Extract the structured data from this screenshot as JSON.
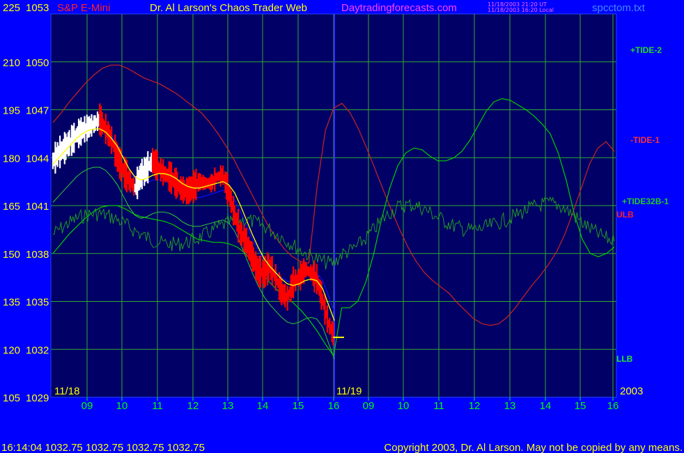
{
  "header": {
    "product": "S&P E-Mini",
    "title": "Dr. Al Larson's Chaos Trader Web",
    "site": "Daytradingforecasts.com",
    "stamp_line1": "11/18/2003 21:20 UT",
    "stamp_line2": "11/18/2003 16:20 Local",
    "file": "spcctom.txt"
  },
  "footer": {
    "quote": "16:14:04  1032.75 1032.75 1032.75 1032.75",
    "copyright": "Copyright 2003, Dr. Al Larson. May not be copied by any means."
  },
  "chart_data": {
    "type": "line",
    "y_left_ticks": [
      225,
      210,
      195,
      180,
      165,
      150,
      135,
      120,
      105
    ],
    "y_right_ticks": [
      1053,
      1050,
      1047,
      1044,
      1041,
      1038,
      1035,
      1032,
      1029
    ],
    "ylim": [
      1029,
      1053
    ],
    "x_ticks": [
      "09",
      "10",
      "11",
      "12",
      "13",
      "14",
      "15",
      "16",
      "09",
      "10",
      "11",
      "12",
      "13",
      "14",
      "15",
      "16"
    ],
    "date_labels": [
      "11/18",
      "11/19",
      "2003"
    ],
    "grid": true,
    "colors": {
      "background": "#000066",
      "grid": "#33aa33",
      "price": "#ff0000",
      "price_up": "#ffffff",
      "average": "#ffff00",
      "tide2": "#00cc00",
      "tide1": "#cc2222",
      "tide32b": "#229922",
      "envelope": "#1111ff"
    },
    "series_labels": [
      "+TIDE-2",
      "-TIDE-1",
      "+TIDE32B-1",
      "ULB",
      "LLB"
    ],
    "last_price": 1032.75,
    "price": [
      1043.8,
      1044.3,
      1044.6,
      1045.0,
      1045.4,
      1045.7,
      1045.9,
      1046.1,
      1046.4,
      1045.8,
      1045.1,
      1044.0,
      1043.2,
      1042.6,
      1042.1,
      1042.9,
      1043.3,
      1043.8,
      1043.4,
      1043.0,
      1042.8,
      1042.4,
      1042.0,
      1041.9,
      1042.2,
      1042.5,
      1042.4,
      1042.4,
      1042.8,
      1042.9,
      1041.8,
      1040.4,
      1039.3,
      1038.7,
      1037.8,
      1036.9,
      1036.8,
      1037.2,
      1036.5,
      1035.6,
      1035.2,
      1036.2,
      1036.5,
      1037.0,
      1036.8,
      1036.4,
      1035.1,
      1033.6,
      1032.8
    ],
    "average": [
      1043.6,
      1044.0,
      1044.4,
      1044.8,
      1045.2,
      1045.5,
      1045.7,
      1045.8,
      1045.8,
      1045.6,
      1045.2,
      1044.7,
      1044.0,
      1043.3,
      1042.8,
      1042.6,
      1042.7,
      1042.9,
      1043.0,
      1043.0,
      1042.9,
      1042.7,
      1042.4,
      1042.2,
      1042.1,
      1042.1,
      1042.2,
      1042.3,
      1042.4,
      1042.5,
      1042.3,
      1041.8,
      1041.0,
      1040.1,
      1039.2,
      1038.4,
      1037.7,
      1037.2,
      1036.8,
      1036.4,
      1036.1,
      1036.0,
      1036.1,
      1036.3,
      1036.4,
      1036.3,
      1035.8,
      1034.8,
      1033.8
    ],
    "tide2": [
      1038.0,
      1038.6,
      1039.2,
      1039.7,
      1040.2,
      1040.6,
      1040.9,
      1041.0,
      1041.0,
      1040.8,
      1040.5,
      1040.3,
      1040.2,
      1040.1,
      1040.0,
      1039.8,
      1039.5,
      1039.2,
      1038.9,
      1038.8,
      1038.7,
      1038.7,
      1038.6,
      1038.4,
      1038.0,
      1037.4,
      1036.8,
      1036.2,
      1035.7,
      1035.3,
      1034.9,
      1034.4,
      1033.8,
      1033.1,
      1032.3,
      1031.6,
      1034.6,
      1034.6,
      1035.0,
      1036.2,
      1038.0,
      1040.2,
      1042.1,
      1043.5,
      1044.3,
      1044.6,
      1044.5,
      1044.1,
      1043.8,
      1043.8,
      1044.0,
      1044.4,
      1045.1,
      1046.0,
      1046.9,
      1047.5,
      1047.7,
      1047.6,
      1047.3,
      1047.0,
      1046.6,
      1046.1,
      1045.5,
      1044.3,
      1042.6,
      1040.5,
      1038.9,
      1038.0,
      1037.8,
      1038.0,
      1038.4
    ],
    "tide1": [
      1046.2,
      1046.8,
      1047.5,
      1048.1,
      1048.7,
      1049.2,
      1049.6,
      1049.8,
      1049.8,
      1049.6,
      1049.3,
      1049.0,
      1048.8,
      1048.6,
      1048.3,
      1048.0,
      1047.6,
      1047.2,
      1046.8,
      1046.2,
      1045.5,
      1044.7,
      1043.8,
      1042.8,
      1041.8,
      1040.8,
      1039.8,
      1039.0,
      1038.3,
      1037.8,
      1037.5,
      1037.4,
      1042.2,
      1045.7,
      1047.1,
      1047.4,
      1046.8,
      1045.8,
      1044.6,
      1043.3,
      1042.0,
      1040.7,
      1039.5,
      1038.4,
      1037.5,
      1036.8,
      1036.3,
      1035.9,
      1035.5,
      1034.9,
      1034.4,
      1033.9,
      1033.6,
      1033.5,
      1033.6,
      1034.0,
      1034.6,
      1035.3,
      1036.0,
      1036.6,
      1037.3,
      1038.1,
      1039.2,
      1040.6,
      1042.1,
      1043.6,
      1044.6,
      1045.0,
      1044.4
    ]
  }
}
